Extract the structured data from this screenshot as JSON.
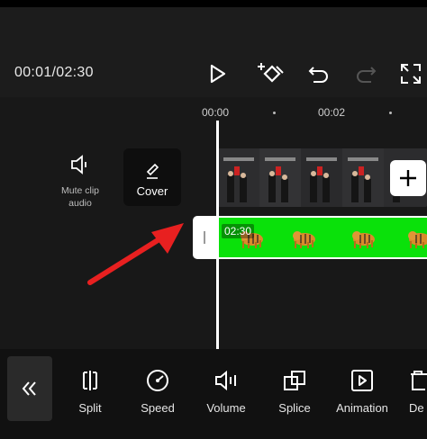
{
  "player": {
    "time_display": "00:01/02:30"
  },
  "controls": {
    "play_icon": "play-icon",
    "keyframe_icon": "add-keyframe-icon",
    "undo_icon": "undo-icon",
    "redo_icon": "redo-icon",
    "fullscreen_icon": "fullscreen-icon"
  },
  "ruler": {
    "labels": [
      "00:00",
      "00:02"
    ]
  },
  "side_buttons": {
    "mute_label_line1": "Mute clip",
    "mute_label_line2": "audio",
    "cover_label": "Cover"
  },
  "overlay_clip": {
    "duration": "02:30",
    "color": "#0AE10A"
  },
  "annotation": {
    "arrow_color": "#E82020"
  },
  "toolbar": {
    "items": [
      {
        "label": "Split",
        "icon": "split-icon"
      },
      {
        "label": "Speed",
        "icon": "speed-icon"
      },
      {
        "label": "Volume",
        "icon": "volume-icon"
      },
      {
        "label": "Splice",
        "icon": "splice-icon"
      },
      {
        "label": "Animation",
        "icon": "animation-icon"
      },
      {
        "label": "De",
        "icon": "delete-icon"
      }
    ]
  }
}
